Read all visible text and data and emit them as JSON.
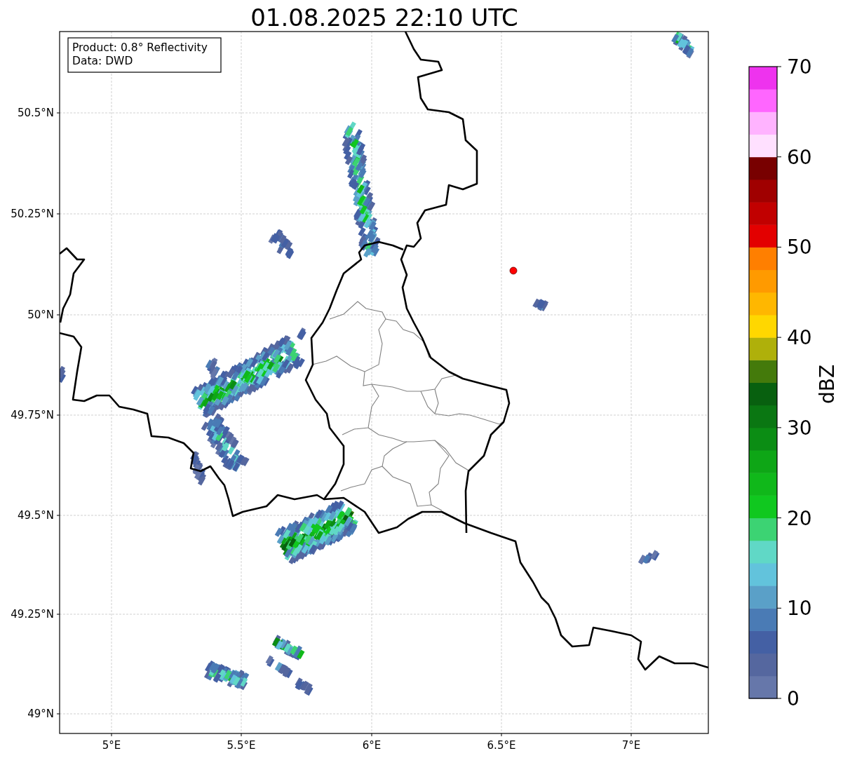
{
  "title": "01.08.2025 22:10 UTC",
  "map": {
    "info_box": [
      "Product: 0.8° Reflectivity",
      "Data: DWD"
    ],
    "lat_labels": [
      "50.5°N",
      "50.25°N",
      "50°N",
      "49.75°N",
      "49.5°N",
      "49.25°N",
      "49°N"
    ],
    "lon_labels": [
      "5°E",
      "5.5°E",
      "6°E",
      "6.5°E",
      "7°E"
    ]
  },
  "colorbar": {
    "label": "dBZ",
    "tick_labels": [
      "70",
      "60",
      "50",
      "40",
      "30",
      "20",
      "10",
      "0"
    ],
    "bins": [
      {
        "color": "#6677aa"
      },
      {
        "color": "#55679f"
      },
      {
        "color": "#4460a4"
      },
      {
        "color": "#4a7bb5"
      },
      {
        "color": "#5aa0c8"
      },
      {
        "color": "#62c3dc"
      },
      {
        "color": "#60d8c6"
      },
      {
        "color": "#3cd373"
      },
      {
        "color": "#10c81f"
      },
      {
        "color": "#10b81a"
      },
      {
        "color": "#0ea616"
      },
      {
        "color": "#0b8d14"
      },
      {
        "color": "#0a7712"
      },
      {
        "color": "#08600f"
      },
      {
        "color": "#447a0b"
      },
      {
        "color": "#afb00a"
      },
      {
        "color": "#ffd700"
      },
      {
        "color": "#ffb700"
      },
      {
        "color": "#ff9a00"
      },
      {
        "color": "#ff7f00"
      },
      {
        "color": "#e30000"
      },
      {
        "color": "#c10000"
      },
      {
        "color": "#a00000"
      },
      {
        "color": "#780000"
      },
      {
        "color": "#ffe0ff"
      },
      {
        "color": "#ffb3ff"
      },
      {
        "color": "#ff66ff"
      },
      {
        "color": "#ee33ee"
      }
    ]
  }
}
